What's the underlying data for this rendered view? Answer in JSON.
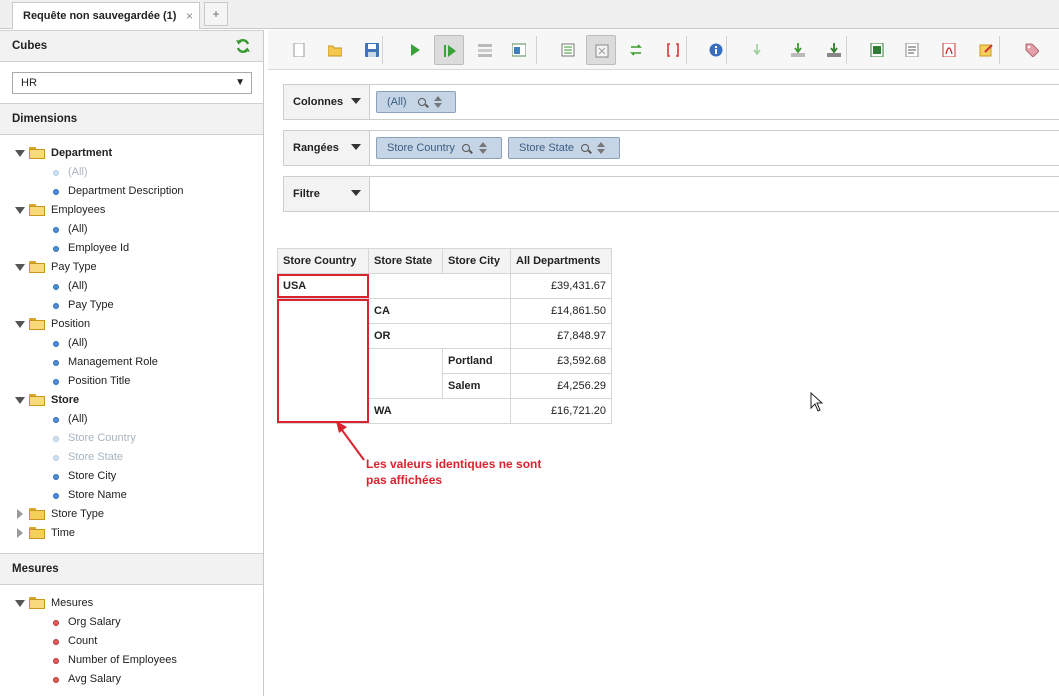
{
  "tabs": [
    {
      "label": "Requête non sauvegardée (1)",
      "close": "×"
    }
  ],
  "tab_add": "+",
  "cubes": {
    "title": "Cubes",
    "selected": "HR",
    "dropdown_arrow": "▼"
  },
  "dimensions": {
    "title": "Dimensions",
    "tree": [
      {
        "label": "Department",
        "type": "folder",
        "open": true,
        "bold": true
      },
      {
        "label": "(All)",
        "type": "leaf",
        "state": "disabled"
      },
      {
        "label": "Department Description",
        "type": "leaf",
        "state": "normal"
      },
      {
        "label": "Employees",
        "type": "folder",
        "open": true
      },
      {
        "label": "(All)",
        "type": "leaf",
        "state": "normal"
      },
      {
        "label": "Employee Id",
        "type": "leaf",
        "state": "normal"
      },
      {
        "label": "Pay Type",
        "type": "folder",
        "open": true
      },
      {
        "label": "(All)",
        "type": "leaf",
        "state": "normal"
      },
      {
        "label": "Pay Type",
        "type": "leaf",
        "state": "normal"
      },
      {
        "label": "Position",
        "type": "folder",
        "open": true
      },
      {
        "label": "(All)",
        "type": "leaf",
        "state": "normal"
      },
      {
        "label": "Management Role",
        "type": "leaf",
        "state": "normal"
      },
      {
        "label": "Position Title",
        "type": "leaf",
        "state": "normal"
      },
      {
        "label": "Store",
        "type": "folder",
        "open": true,
        "bold": true
      },
      {
        "label": "(All)",
        "type": "leaf",
        "state": "normal"
      },
      {
        "label": "Store Country",
        "type": "leaf",
        "state": "disabled"
      },
      {
        "label": "Store State",
        "type": "leaf",
        "state": "disabled"
      },
      {
        "label": "Store City",
        "type": "leaf",
        "state": "normal"
      },
      {
        "label": "Store Name",
        "type": "leaf",
        "state": "normal"
      },
      {
        "label": "Store Type",
        "type": "folder",
        "open": false
      },
      {
        "label": "Time",
        "type": "folder",
        "open": false
      }
    ]
  },
  "measures": {
    "title": "Mesures",
    "tree": [
      {
        "label": "Mesures",
        "type": "folder",
        "open": true
      },
      {
        "label": "Org Salary",
        "type": "measure"
      },
      {
        "label": "Count",
        "type": "measure"
      },
      {
        "label": "Number of Employees",
        "type": "measure"
      },
      {
        "label": "Avg Salary",
        "type": "measure"
      }
    ]
  },
  "toolbar": {
    "buttons": [
      "new-query-icon",
      "open-icon",
      "save-icon",
      "run-query-icon",
      "auto-execute-icon",
      "hide-parents-icon",
      "show-mdx-icon",
      "non-empty-icon",
      "zoom-mode-icon",
      "swap-axes-icon",
      "mdx-editor-icon",
      "explain-icon",
      "drill-down-icon",
      "export-icon",
      "export-all-icon",
      "export-excel-icon",
      "export-csv-icon",
      "export-pdf-icon",
      "edit-icon",
      "tag-icon"
    ]
  },
  "zones": {
    "columns": {
      "label": "Colonnes",
      "pills": [
        {
          "label": "(All)"
        }
      ]
    },
    "rows": {
      "label": "Rangées",
      "pills": [
        {
          "label": "Store Country"
        },
        {
          "label": "Store State"
        }
      ]
    },
    "filter": {
      "label": "Filtre",
      "pills": []
    }
  },
  "table": {
    "headers": [
      "Store Country",
      "Store State",
      "Store City",
      "All Departments"
    ],
    "rows": [
      {
        "country": "USA",
        "state": "",
        "city": "",
        "value": "£39,431.67"
      },
      {
        "country": "",
        "state": "CA",
        "city": "",
        "value": "£14,861.50"
      },
      {
        "country": "",
        "state": "OR",
        "city": "",
        "value": "£7,848.97"
      },
      {
        "country": "",
        "state": "",
        "city": "Portland",
        "value": "£3,592.68"
      },
      {
        "country": "",
        "state": "",
        "city": "Salem",
        "value": "£4,256.29"
      },
      {
        "country": "",
        "state": "WA",
        "city": "",
        "value": "£16,721.20"
      }
    ]
  },
  "annotation": {
    "text": "Les valeurs identiques ne sont pas affichées",
    "color": "#d9232e"
  },
  "colors": {
    "pill_bg": "#c5d5e6",
    "pill_text": "#3c5d83",
    "accent_red": "#d9232e",
    "refresh_green": "#3a9b2e"
  }
}
